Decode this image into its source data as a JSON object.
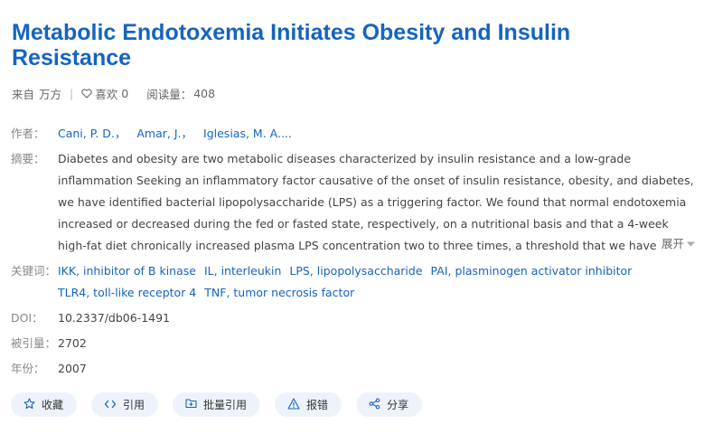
{
  "title": "Metabolic Endotoxemia Initiates Obesity and Insulin Resistance",
  "meta": {
    "source_label": "来自",
    "source": "万方",
    "separator": "|",
    "like_label": "喜欢",
    "like_count": "0",
    "views_label": "阅读量：",
    "views": "408"
  },
  "fields": {
    "authors_label": "作者：",
    "authors": [
      "Cani, P. D.，",
      "Amar, J.，",
      "Iglesias, M. A...."
    ],
    "abstract_label": "摘要：",
    "abstract": "Diabetes and obesity are two metabolic diseases characterized by insulin resistance and a low-grade inflammation Seeking an inflammatory factor causative of the onset of insulin resistance, obesity, and diabetes, we have identified bacterial lipopolysaccharide (LPS) as a triggering factor. We found that normal endotoxemia increased or decreased during the fed or fasted state, respectively, on a nutritional basis and that a 4-week high-fat diet chronically increased plasma LPS concentration two to three times, a threshold that we have defined",
    "expand_label": "展开",
    "keywords_label": "关键词：",
    "keywords_line1": [
      "IKK, inhibitor of B kinase",
      "IL, interleukin",
      "LPS, lipopolysaccharide",
      "PAI, plasminogen activator inhibitor"
    ],
    "keywords_line2": [
      "TLR4, toll-like receptor 4",
      "TNF, tumor necrosis factor"
    ],
    "doi_label": "DOI：",
    "doi": "10.2337/db06-1491",
    "cited_label": "被引量：",
    "cited": "2702",
    "year_label": "年份：",
    "year": "2007"
  },
  "actions": [
    {
      "label": "收藏",
      "icon": "star-icon"
    },
    {
      "label": "引用",
      "icon": "code-icon"
    },
    {
      "label": "批量引用",
      "icon": "folder-icon"
    },
    {
      "label": "报错",
      "icon": "warning-icon"
    },
    {
      "label": "分享",
      "icon": "share-icon"
    }
  ],
  "colors": {
    "title": "#1564c0",
    "link": "#1564c0",
    "label": "#888888",
    "button_bg": "#eef3fb"
  }
}
